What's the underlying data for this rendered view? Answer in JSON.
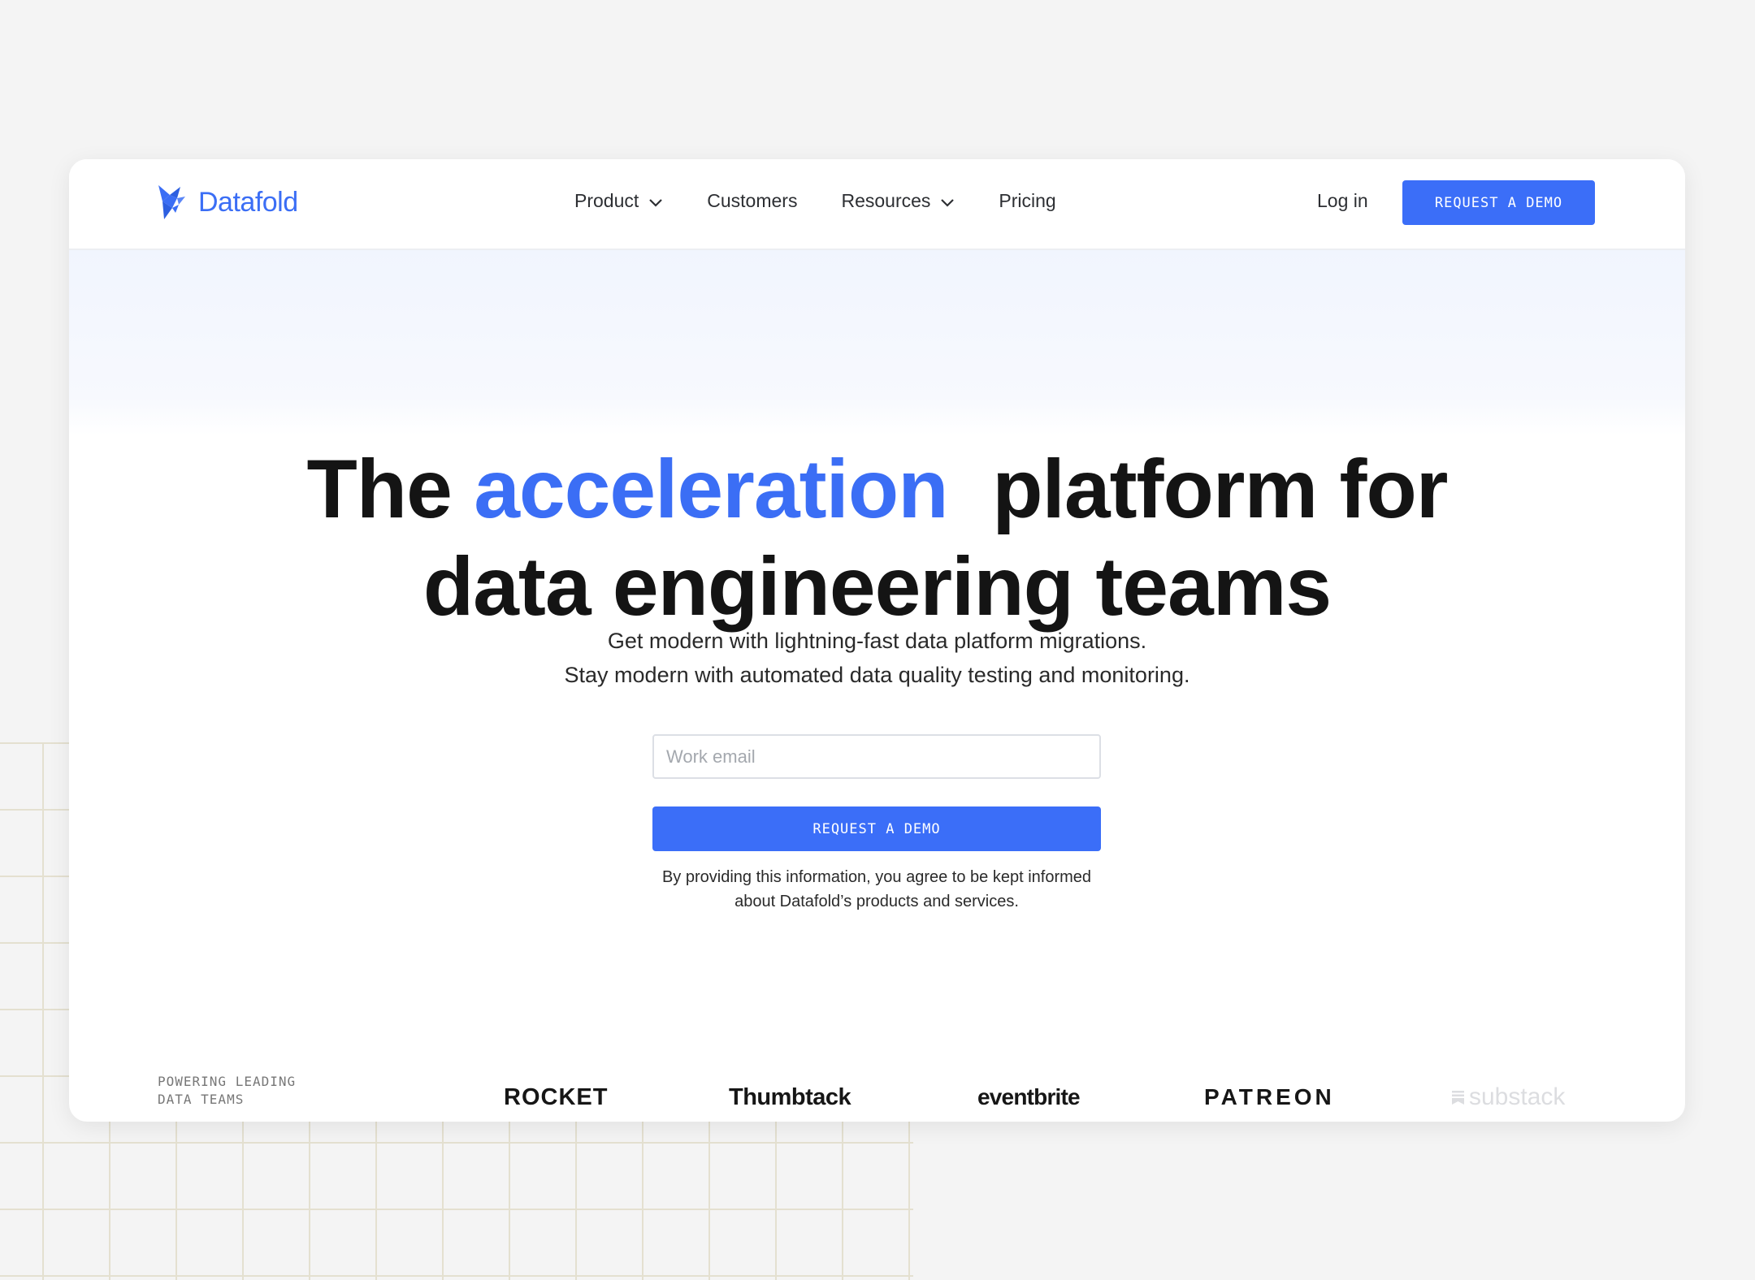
{
  "brand": {
    "name": "Datafold",
    "accent_color": "#3b6ef5"
  },
  "nav": {
    "items": [
      {
        "label": "Product",
        "has_dropdown": true
      },
      {
        "label": "Customers",
        "has_dropdown": false
      },
      {
        "label": "Resources",
        "has_dropdown": true
      },
      {
        "label": "Pricing",
        "has_dropdown": false
      }
    ],
    "login_label": "Log in",
    "demo_label": "REQUEST A DEMO"
  },
  "hero": {
    "headline_prefix": "The ",
    "headline_accent": "acceleration",
    "headline_suffix": "  platform for",
    "headline_line2": "data engineering teams",
    "subline1": "Get modern with lightning-fast data platform migrations.",
    "subline2": "Stay modern with automated data quality testing and monitoring.",
    "email_placeholder": "Work email",
    "cta_label": "REQUEST A DEMO",
    "disclaimer": "By providing this information, you agree to be kept informed about Datafold’s products and services."
  },
  "customers": {
    "label": "POWERING LEADING\nDATA TEAMS",
    "logos": [
      "ROCKET",
      "Thumbtack",
      "eventbrite",
      "PATREON",
      "substack"
    ]
  },
  "icons": {
    "logo": "datafold-logo-icon",
    "dropdown": "chevron-down-icon",
    "substack": "substack-logo-icon"
  }
}
